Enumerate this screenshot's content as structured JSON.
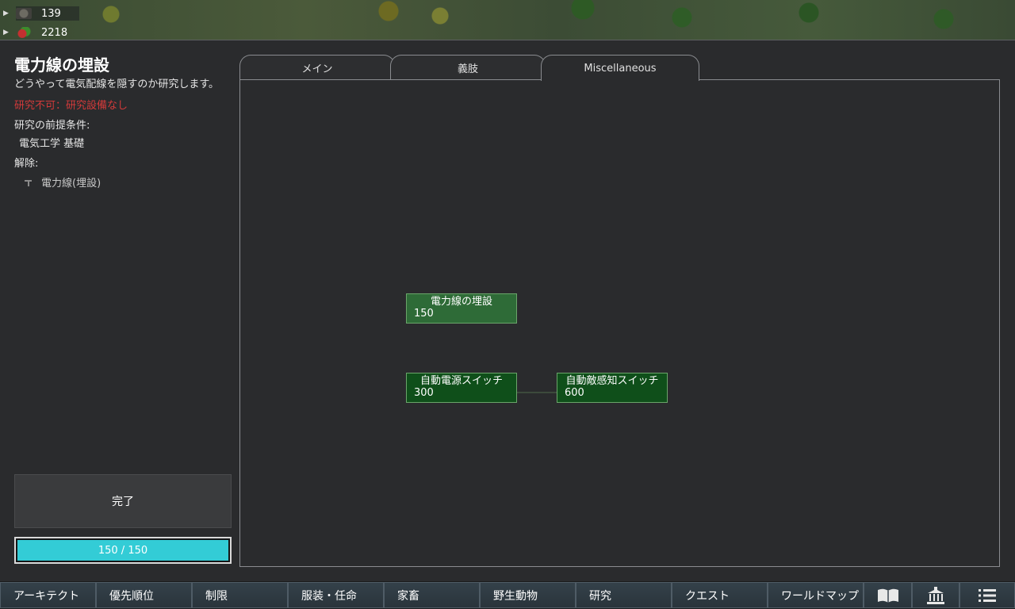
{
  "resources": [
    {
      "icon": "silver-icon",
      "value": "139"
    },
    {
      "icon": "food-icon",
      "value": "2218"
    }
  ],
  "project": {
    "title": "電力線の埋設",
    "description": "どうやって電気配線を隠すのか研究します。",
    "status": "研究不可：研究設備なし",
    "prereq_label": "研究の前提条件:",
    "prereq": "電気工学 基礎",
    "unlock_label": "解除:",
    "unlocks": [
      "電力線(埋設)"
    ]
  },
  "done_button": "完了",
  "progress": {
    "text": "150 / 150",
    "fraction": 1.0
  },
  "tabs": [
    {
      "label": "メイン"
    },
    {
      "label": "義肢"
    },
    {
      "label": "Miscellaneous"
    }
  ],
  "nodes": [
    {
      "name": "電力線の埋設",
      "cost": "150"
    },
    {
      "name": "自動電源スイッチ",
      "cost": "300"
    },
    {
      "name": "自動敵感知スイッチ",
      "cost": "600"
    }
  ],
  "bottom_bar": {
    "architect": "アーキテクト",
    "priority": "優先順位",
    "restrict": "制限",
    "assign": "服装・任命",
    "animals": "家畜",
    "wildlife": "野生動物",
    "research": "研究",
    "quests": "クエスト",
    "world": "ワールドマップ",
    "icons": [
      "book-icon",
      "building-icon",
      "menu-icon"
    ]
  },
  "colors": {
    "accent": "#33ccd6",
    "status_red": "#d23a3a",
    "node_completed": "#2e6b37",
    "node_available": "#0f4f1a"
  }
}
